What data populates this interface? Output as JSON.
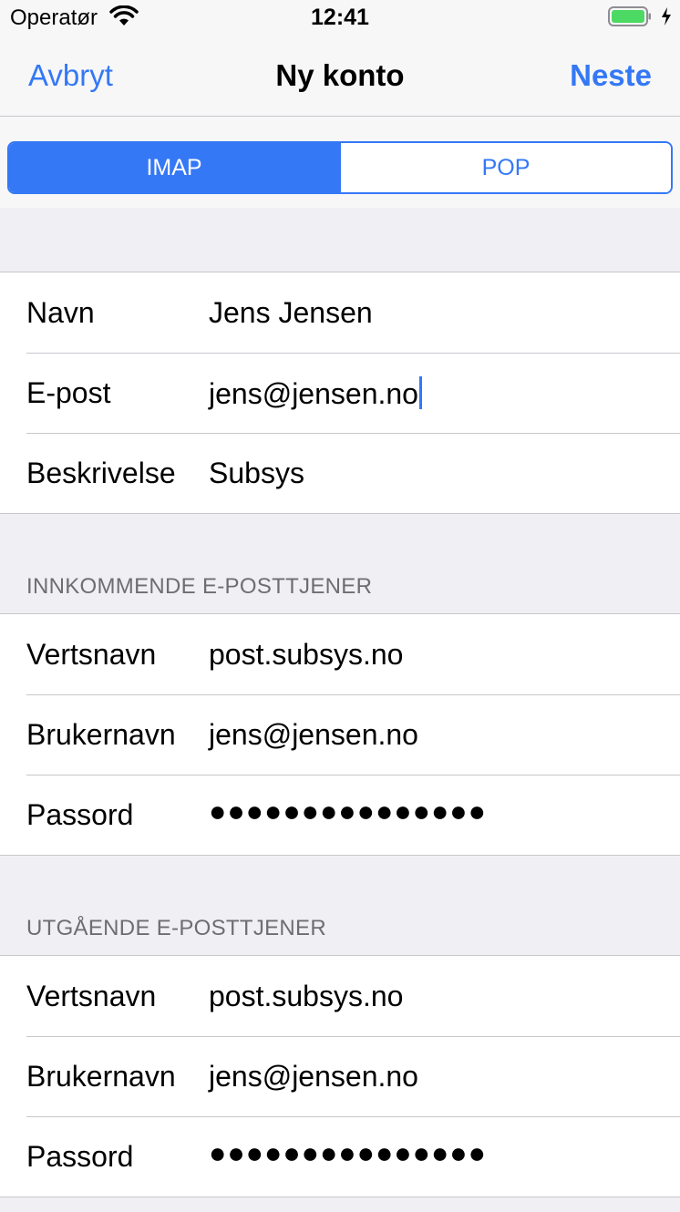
{
  "status_bar": {
    "carrier": "Operatør",
    "time": "12:41",
    "wifi_icon": "wifi-icon",
    "battery_icon": "battery-icon",
    "charging_icon": "charging-icon",
    "battery_color": "#4cd964"
  },
  "nav": {
    "cancel_label": "Avbryt",
    "title": "Ny konto",
    "next_label": "Neste",
    "accent_color": "#3478f6"
  },
  "segments": {
    "imap": "IMAP",
    "pop": "POP",
    "selected": "IMAP"
  },
  "account": {
    "name_label": "Navn",
    "name_value": "Jens Jensen",
    "email_label": "E-post",
    "email_value": "jens@jensen.no",
    "description_label": "Beskrivelse",
    "description_value": "Subsys"
  },
  "incoming": {
    "header": "INNKOMMENDE E-POSTTJENER",
    "host_label": "Vertsnavn",
    "host_value": "post.subsys.no",
    "user_label": "Brukernavn",
    "user_value": "jens@jensen.no",
    "password_label": "Passord",
    "password_value": "●●●●●●●●●●●●●●●"
  },
  "outgoing": {
    "header": "UTGÅENDE E-POSTTJENER",
    "host_label": "Vertsnavn",
    "host_value": "post.subsys.no",
    "user_label": "Brukernavn",
    "user_value": "jens@jensen.no",
    "password_label": "Passord",
    "password_value": "●●●●●●●●●●●●●●●"
  }
}
